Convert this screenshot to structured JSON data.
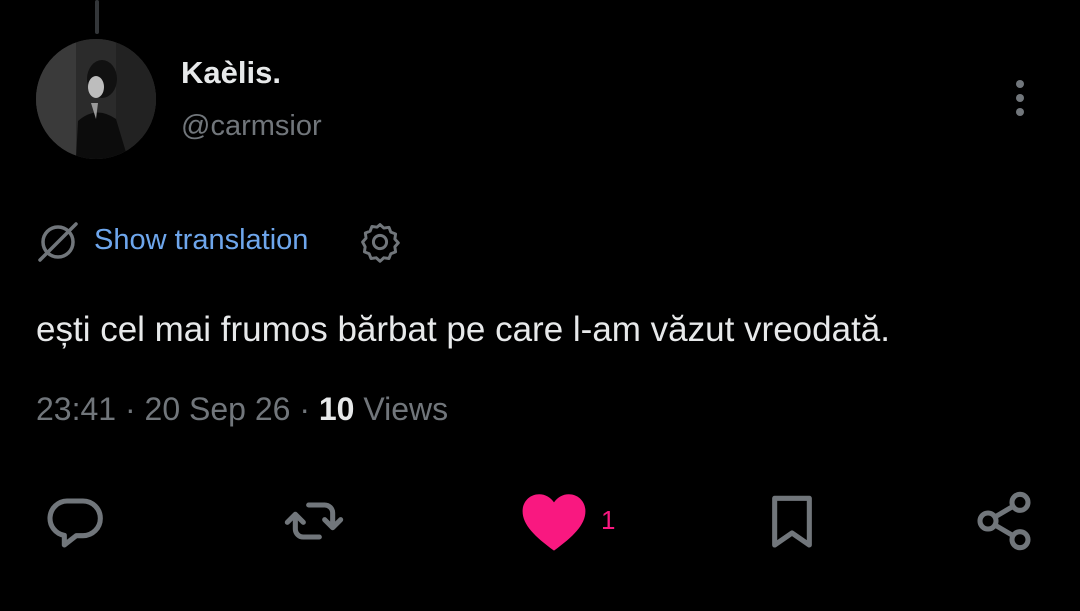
{
  "tweet": {
    "author": {
      "display_name": "Kaèlis.",
      "handle": "@carmsior",
      "avatar": "profile-photo"
    },
    "translation": {
      "label": "Show translation",
      "icon": "globe-off-icon",
      "settings_icon": "gear-icon"
    },
    "text": "ești cel mai frumos bărbat pe care l-am văzut vreodată.",
    "meta": {
      "time": "23:41",
      "date": "20 Sep 26",
      "separator": "·",
      "views_count": "10",
      "views_label": "Views"
    },
    "actions": {
      "reply_icon": "reply-icon",
      "retweet_icon": "retweet-icon",
      "like_icon": "heart-icon",
      "like_count": "1",
      "bookmark_icon": "bookmark-icon",
      "share_icon": "share-icon",
      "more_icon": "more-vertical-icon"
    }
  },
  "colors": {
    "background": "#000000",
    "primary_text": "#e7e9ea",
    "secondary_text": "#71767b",
    "link": "#6ea6ec",
    "like": "#f91880",
    "icon": "#71767b"
  }
}
